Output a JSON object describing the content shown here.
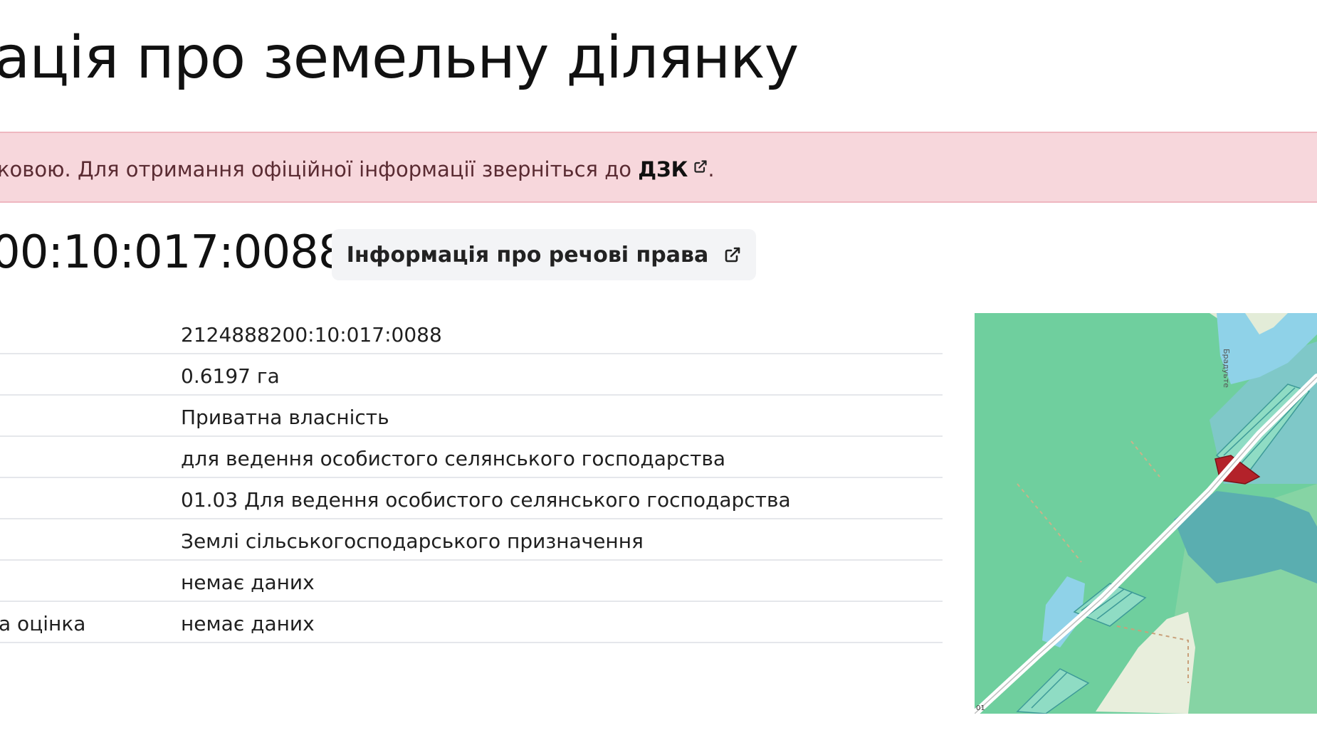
{
  "page": {
    "title": "ація про земельну ділянку"
  },
  "alert": {
    "text": "ковою. Для отримання офіційної інформації зверніться до ",
    "link_label": "ДЗК",
    "suffix": ".",
    "link_icon": "external-link-icon"
  },
  "parcel": {
    "cadastral_number": "00:10:017:0088",
    "rights_button_label": "Інформація про речові права",
    "rights_button_icon": "external-link-icon"
  },
  "info_rows": [
    {
      "label": "",
      "value": "2124888200:10:017:0088"
    },
    {
      "label": "",
      "value": "0.6197 га"
    },
    {
      "label": "",
      "value": "Приватна власність"
    },
    {
      "label": "",
      "value": "для ведення особистого селянського господарства"
    },
    {
      "label": "",
      "value": "01.03 Для ведення особистого селянського господарства"
    },
    {
      "label": "",
      "value": "Землі сільськогосподарського призначення"
    },
    {
      "label": "",
      "value": "немає даних"
    },
    {
      "label": "а оцінка",
      "value": "немає даних"
    }
  ],
  "map": {
    "street_label": "Брадуьте",
    "corner_label": "01",
    "colors": {
      "forest": "#6fcf9e",
      "forest_dark": "#5cc493",
      "field": "#e8eedc",
      "parcels": "#7fc8c8",
      "parcels_dark": "#5aaeb0",
      "water": "#8fd2e8",
      "selected": "#b3222a",
      "road": "#ffffff"
    }
  },
  "colors": {
    "alert_bg": "#f7d7dc",
    "alert_border": "#efb7c0",
    "button_bg": "#f3f4f6",
    "divider": "#e5e7eb"
  }
}
